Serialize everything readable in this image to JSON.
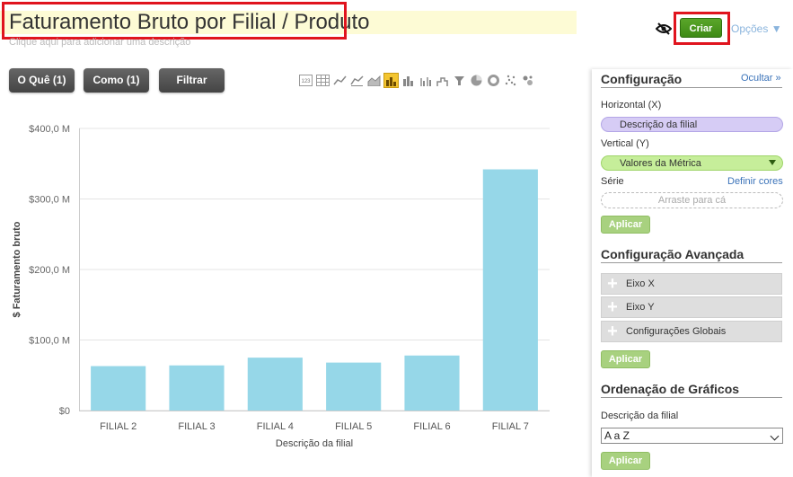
{
  "header": {
    "title": "Faturamento Bruto por Filial / Produto",
    "description_hint": "Clique aqui para adicionar uma descrição",
    "create_label": "Criar",
    "options_label": "Opções ▼"
  },
  "toolbar": {
    "what_label": "O Quê (1)",
    "how_label": "Como (1)",
    "filter_label": "Filtrar",
    "chart_type_icons": [
      "number-icon",
      "table-icon",
      "line-icon",
      "line-area-icon",
      "area-icon",
      "bar-icon",
      "stacked-bar-icon",
      "grouped-bar-icon",
      "step-bar-icon",
      "funnel-icon",
      "pie-icon",
      "donut-icon",
      "scatter-icon",
      "bubble-icon"
    ],
    "selected_chart_icon": "bar-icon"
  },
  "chart_data": {
    "type": "bar",
    "categories": [
      "FILIAL 2",
      "FILIAL 3",
      "FILIAL 4",
      "FILIAL 5",
      "FILIAL 6",
      "FILIAL 7"
    ],
    "values": [
      63,
      64,
      75,
      68,
      78,
      342
    ],
    "ylabel": "$ Faturamento bruto",
    "xlabel": "Descrição da filial",
    "ylim": [
      0,
      400
    ],
    "yticks": [
      0,
      100,
      200,
      300,
      400
    ],
    "ytick_labels": [
      "$0",
      "$100,0 M",
      "$200,0 M",
      "$300,0 M",
      "$400,0 M"
    ],
    "bar_color": "#96d7e8",
    "grid": true
  },
  "panel": {
    "config_title": "Configuração",
    "hide_label": "Ocultar »",
    "horizontal_label": "Horizontal (X)",
    "horizontal_value": "Descrição da filial",
    "vertical_label": "Vertical (Y)",
    "vertical_value": "Valores da Métrica",
    "series_label": "Série",
    "define_colors_label": "Definir cores",
    "drop_placeholder": "Arraste para cá",
    "apply_label": "Aplicar",
    "advanced_title": "Configuração Avançada",
    "advanced_items": [
      "Eixo X",
      "Eixo Y",
      "Configurações Globais"
    ],
    "sort_title": "Ordenação de Gráficos",
    "sort_field_label": "Descrição da filial",
    "sort_value": "A a Z"
  },
  "colors": {
    "highlight": "#e0141e",
    "create_green": "#4a9a1e",
    "bar": "#96d7e8",
    "selected_icon": "#f3c531"
  }
}
